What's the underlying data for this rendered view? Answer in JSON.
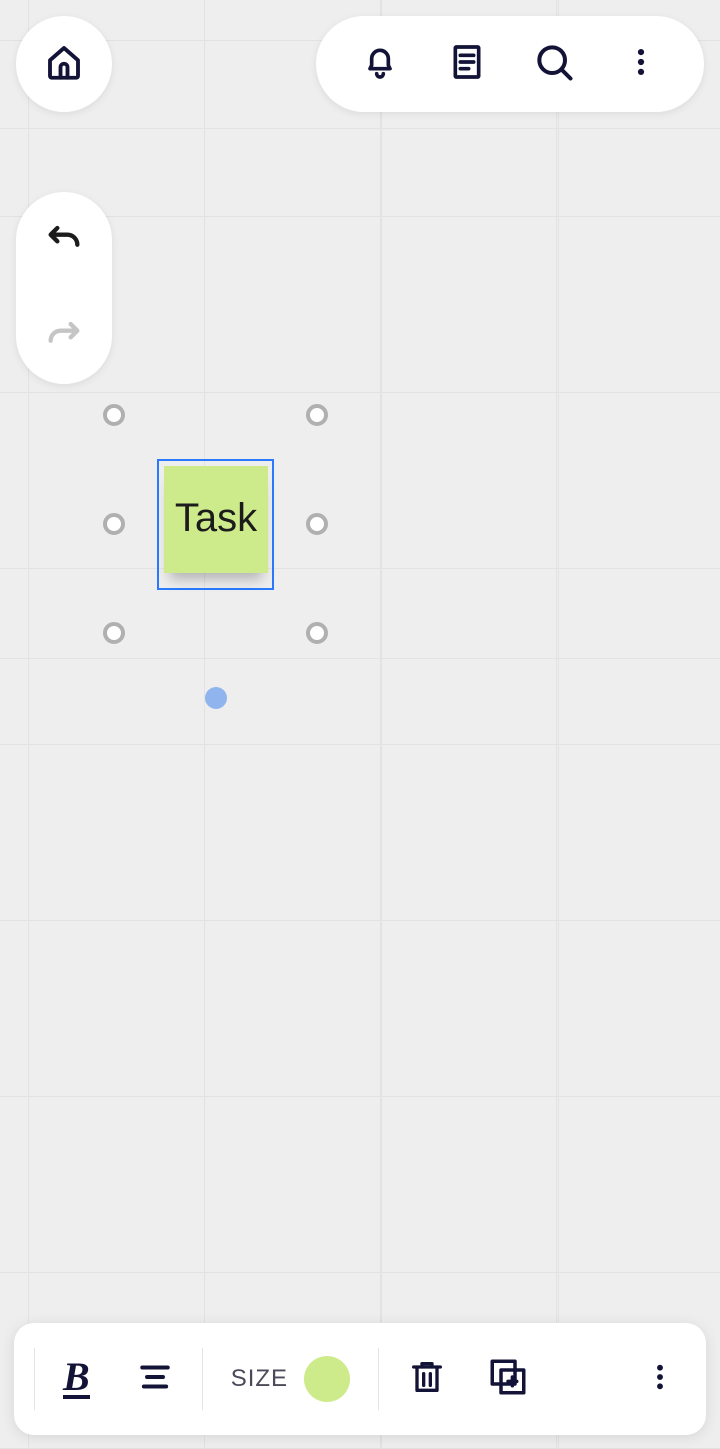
{
  "header": {
    "home_icon": "home-icon",
    "actions": {
      "notifications_icon": "bell-icon",
      "board_list_icon": "document-list-icon",
      "search_icon": "search-icon",
      "more_icon": "more-vertical-icon"
    }
  },
  "history": {
    "undo_icon": "undo-icon",
    "undo_enabled": true,
    "redo_icon": "redo-icon",
    "redo_enabled": false
  },
  "canvas": {
    "sticky_note": {
      "text": "Task",
      "color": "#CDEB8B",
      "selected": true
    }
  },
  "toolbar": {
    "bold_label": "B",
    "align_icon": "align-center-icon",
    "size_label": "SIZE",
    "color_swatch": "#CDEB8B",
    "delete_icon": "trash-icon",
    "duplicate_icon": "copy-plus-icon",
    "more_icon": "more-vertical-icon"
  }
}
